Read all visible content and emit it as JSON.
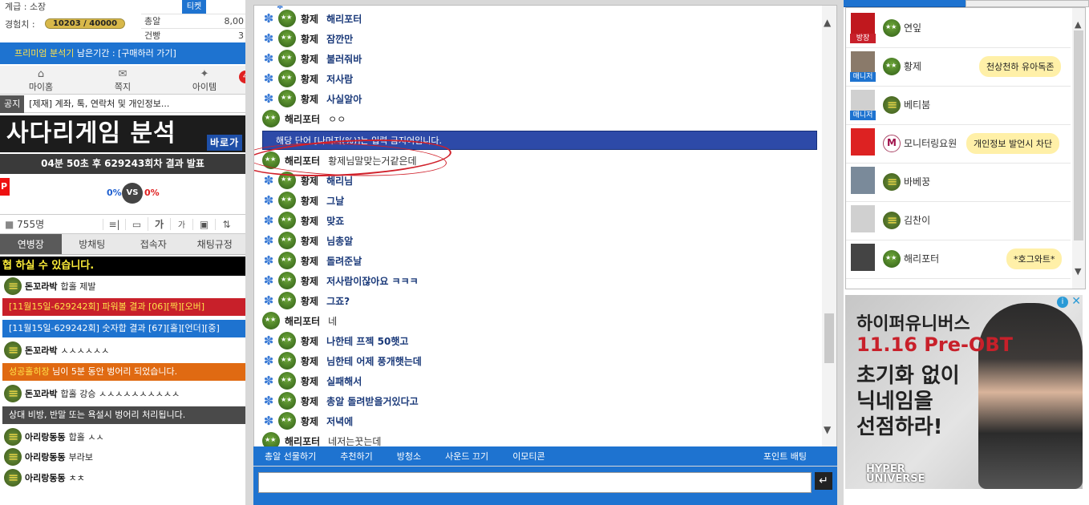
{
  "left": {
    "level_label": "계급 : 소장",
    "exp_label": "경험치 :",
    "exp_value": "10203 / 40000",
    "stats": [
      {
        "k": "",
        "v": "",
        "badge": "티켓"
      },
      {
        "k": "총알",
        "v": "8,00"
      },
      {
        "k": "건빵",
        "v": "3"
      }
    ],
    "premium": {
      "name": "프리미엄 분석기",
      "rest": " 남은기간 : [구매하러 가기]"
    },
    "nav": [
      {
        "label": "마이홈",
        "icon": "⌂"
      },
      {
        "label": "쪽지",
        "icon": "✉"
      },
      {
        "label": "아이템",
        "icon": "✦"
      }
    ],
    "nav_badge": "4",
    "notice_tag": "공지",
    "notice_text": "[제재] 계좌, 톡, 연락처 및 개인정보...",
    "logo_text": "사다리게임 분석",
    "logo_sub": "바로가",
    "timer": "04분 50초 후 629243회차 결과 발표",
    "vs_left": "0%",
    "vs_mid": "VS",
    "vs_right": "0%",
    "vs_p": "P",
    "users": "755명",
    "tool_icons": [
      "≡|",
      "▭",
      "가",
      "가",
      "▣",
      "⇅"
    ],
    "tabs": [
      "연병장",
      "방채팅",
      "접속자",
      "채팅규정"
    ],
    "chat": {
      "top": "협 하실 수 있습니다.",
      "m1_name": "돈꼬라박",
      "m1_text": "합홀 제발",
      "bar1": "[11월15일-629242회] 파워볼 결과 [06][짝][오버]",
      "bar2": "[11월15일-629242회] 숫자합 결과 [67][홀][언더][중]",
      "m2_name": "돈꼬라박",
      "m2_text": "ㅅㅅㅅㅅㅅㅅ",
      "bar3_name": "성공홀히장",
      "bar3_text": " 님이 5분 동안 벙어리 되었습니다.",
      "m3_name": "돈꼬라박",
      "m3_text": "합홀 강승 ㅅㅅㅅㅅㅅㅅㅅㅅㅅㅅ",
      "bar4": "상대 비방, 반말 또는 욕설시 벙어리 처리됩니다.",
      "m4_name": "아리랑동동",
      "m4_text": "합홀 ㅅㅅ",
      "m5_name": "아리랑동동",
      "m5_text": "부라보",
      "m6_name": "아리랑동동",
      "m6_text": "ㅊㅊ"
    }
  },
  "middle": {
    "messages": [
      {
        "name": "황제",
        "text": "해리포터"
      },
      {
        "name": "황제",
        "text": "잠깐만"
      },
      {
        "name": "황제",
        "text": "불러줘바"
      },
      {
        "name": "황제",
        "text": "저사람"
      },
      {
        "name": "황제",
        "text": "사실알아"
      },
      {
        "name": "해리포터",
        "text": "ㅇㅇ"
      },
      {
        "name": "해리포터",
        "text": "황제님말맞는거같은데"
      },
      {
        "name": "황제",
        "text": "해리님"
      },
      {
        "name": "황제",
        "text": "그날"
      },
      {
        "name": "황제",
        "text": "맞죠"
      },
      {
        "name": "황제",
        "text": "님총알"
      },
      {
        "name": "황제",
        "text": "돌려준날"
      },
      {
        "name": "황제",
        "text": "저사람이잖아요 ㅋㅋㅋ"
      },
      {
        "name": "황제",
        "text": "그죠?"
      },
      {
        "name": "해리포터",
        "text": "네"
      },
      {
        "name": "황제",
        "text": "나한테 프젝 50햇고"
      },
      {
        "name": "황제",
        "text": "님한테 어제 풍개햇는데"
      },
      {
        "name": "황제",
        "text": "실패해서"
      },
      {
        "name": "황제",
        "text": "총알 돌려받을거있다고"
      },
      {
        "name": "황제",
        "text": "저녁에"
      },
      {
        "name": "해리포터",
        "text": "네저는꿋는데"
      }
    ],
    "banner": "해당 단어 [나머지(%)]는 입력 금지어입니다.",
    "actions": [
      "총알 선물하기",
      "추천하기",
      "방청소",
      "사운드 끄기",
      "이모티콘"
    ],
    "point_bet": "포인트 배팅",
    "enter_icon": "↵"
  },
  "right": {
    "users": [
      {
        "name": "연잎",
        "tag": "방장",
        "tag_color": "#c8202a",
        "av": "#c0181e",
        "rank": "g"
      },
      {
        "name": "황제",
        "tag": "매니저",
        "tag_color": "#1e73d0",
        "av": "#8a7a6a",
        "rank": "g",
        "bubble": "천상천하 유아독존"
      },
      {
        "name": "베티붐",
        "tag": "매니저",
        "tag_color": "#1e73d0",
        "av": "#d0d0d0",
        "rank": "b"
      },
      {
        "name": "모니터링요원",
        "av": "#d22",
        "rank": "m",
        "bubble": "개인정보 발언시 차단"
      },
      {
        "name": "바베꿍",
        "av": "#7a8a9a",
        "rank": "b"
      },
      {
        "name": "김찬이",
        "av": "#d0d0d0",
        "rank": "b"
      },
      {
        "name": "해리포터",
        "av": "#444",
        "rank": "g",
        "bubble": "*호그와트*"
      }
    ],
    "ad": {
      "line1": "하이퍼유니버스",
      "line2": "11.16 Pre-OBT",
      "line3": "초기화 없이",
      "line4": "닉네임을",
      "line5": "선점하라!",
      "brand": "HYPER UNIVERSE"
    }
  }
}
